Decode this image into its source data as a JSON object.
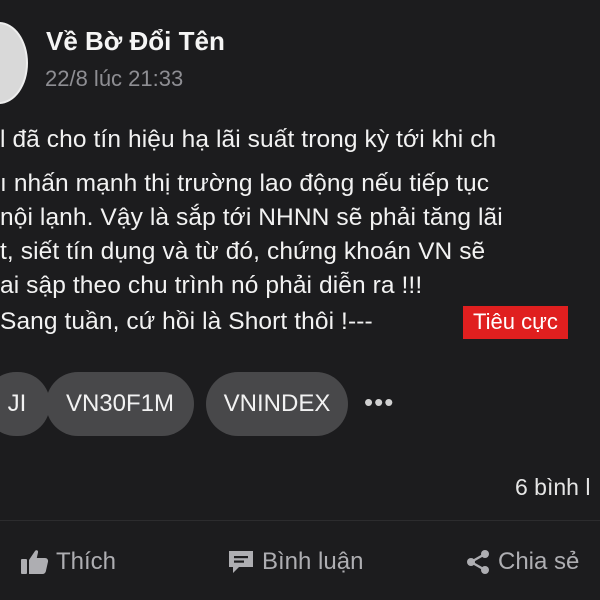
{
  "post": {
    "author": "Về Bờ Đổi Tên",
    "timestamp": "22/8 lúc 21:33",
    "lines": [
      "l đã cho tín hiệu hạ lãi suất trong kỳ tới khi ch",
      "ı nhấn mạnh thị trường lao động nếu tiếp tục",
      "nội lạnh. Vậy là sắp tới NHNN sẽ phải tăng lãi",
      "t, siết tín dụng và từ đó, chứng khoán VN sẽ",
      "ai sập theo chu trình nó phải diễn ra !!!",
      "Sang tuần, cứ hồi là Short thôi !---"
    ],
    "sentiment_badge": "Tiêu cực",
    "sentiment_color": "#e01f1f"
  },
  "tags": [
    "JI",
    "VN30F1M",
    "VNINDEX"
  ],
  "more_label": "•••",
  "comment_count": "6 bình l",
  "actions": {
    "like": "Thích",
    "comment": "Bình luận",
    "share": "Chia sẻ"
  }
}
